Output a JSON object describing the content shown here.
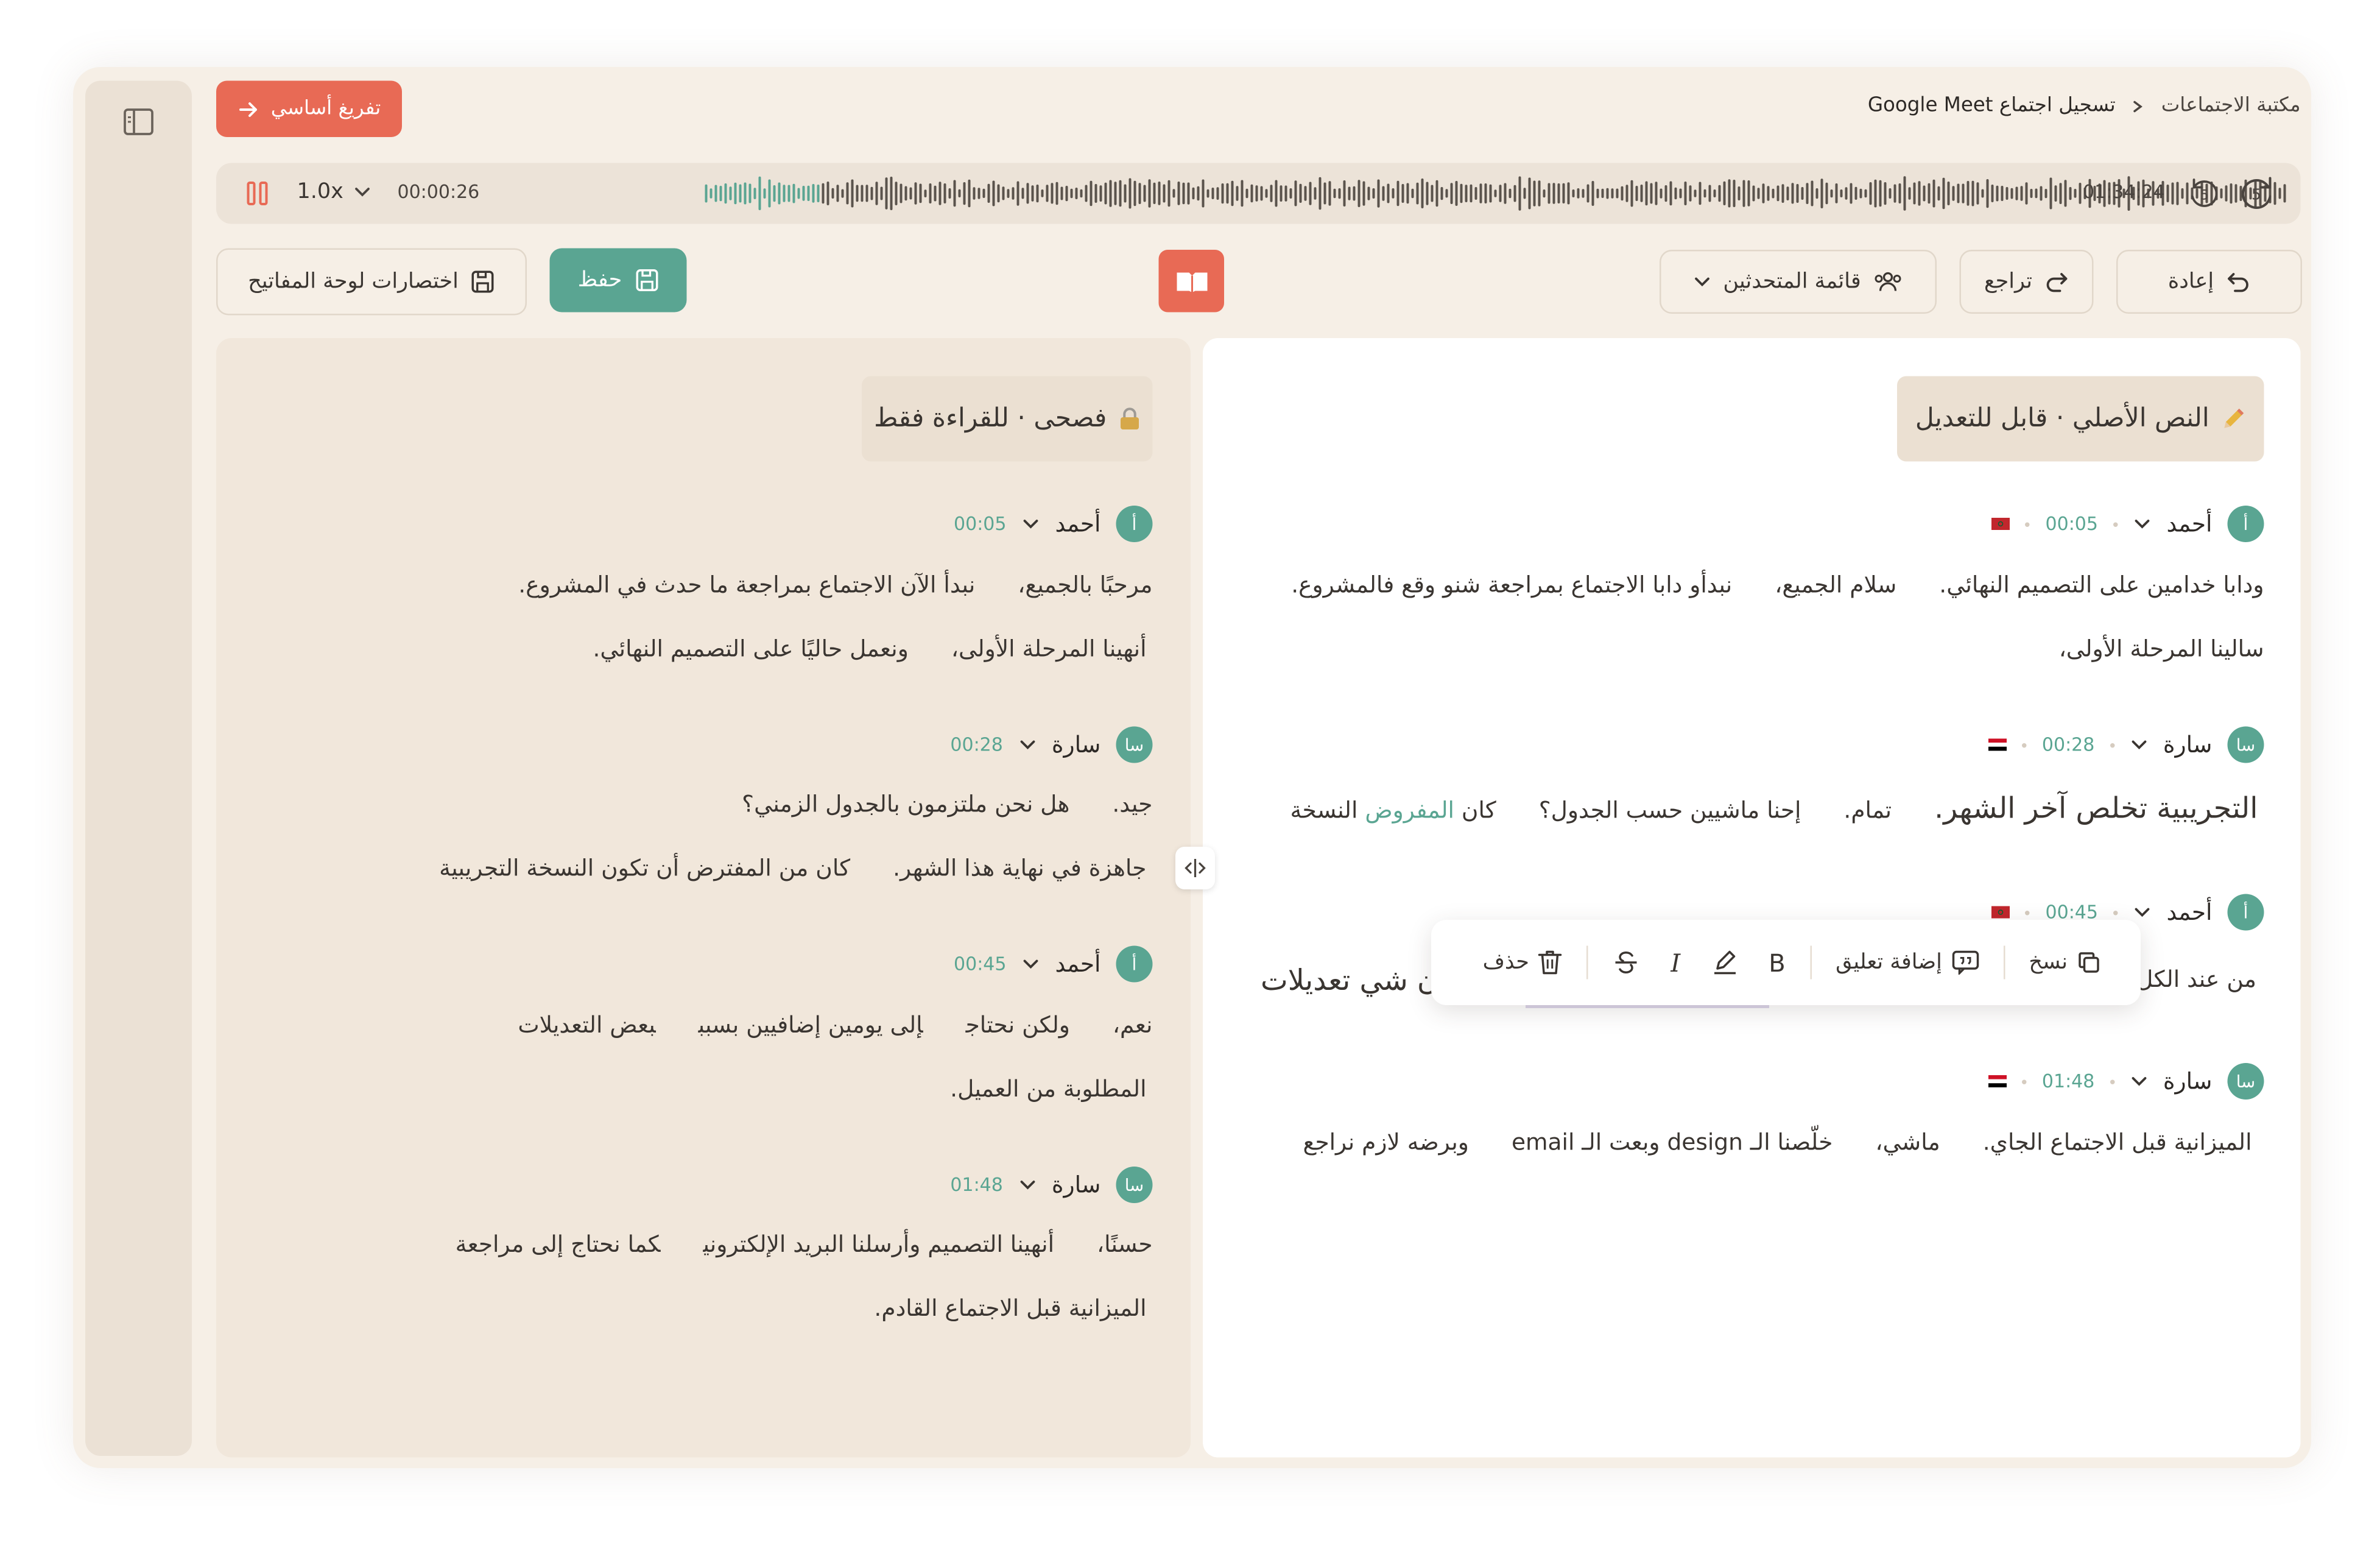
{
  "header": {
    "breadcrumb_root": "مكتبة الاجتماعات",
    "breadcrumb_current": "تسجيل اجتماع Google Meet",
    "primary_button": "تفريغ أساسي"
  },
  "player": {
    "current_time": "00:00:26",
    "total_time": "01:34:24",
    "speed": "1.0x",
    "skip_back": "5",
    "skip_forward": "5",
    "progress": 0.005
  },
  "toolbar": {
    "redo": "إعادة",
    "undo": "تراجع",
    "speakers": "قائمة المتحدثين",
    "save": "حفظ",
    "shortcuts": "اختصارات لوحة المفاتيح"
  },
  "right_panel": {
    "tag": "النص الأصلي · قابل للتعديل",
    "blocks": [
      {
        "avatar": "أ",
        "speaker": "أحمد",
        "time": "00:05",
        "flag": "morocco",
        "line1": [
          "ودابا خدامين على التصميم النهائي.",
          "سلام الجميع،",
          "نبدأو دابا الاجتماع بمراجعة شنو وقع فالمشروع."
        ],
        "line2": [
          "سالينا المرحلة الأولى،"
        ]
      },
      {
        "avatar": "سا",
        "speaker": "سارة",
        "time": "00:28",
        "flag": "egypt",
        "line1_big": "التجريبية تخلص آخر الشهر.",
        "line1": [
          "تمام.",
          "إحنا ماشيين حسب الجدول؟"
        ],
        "line1_pre": "كان",
        "line1_hl": "المفروض",
        "line1_post": "النسخة"
      },
      {
        "avatar": "أ",
        "speaker": "أحمد",
        "time": "00:45",
        "flag": "morocco",
        "line1_start": "من عند الكل",
        "line1_end": "ن شي تعديلات"
      },
      {
        "avatar": "سا",
        "speaker": "سارة",
        "time": "01:48",
        "flag": "egypt",
        "line1": [
          "الميزانية قبل الاجتماع الجاي.",
          "ماشي،",
          "خلّصنا الـ design وبعت الـ email",
          "وبرضه لازم نراجع"
        ]
      }
    ]
  },
  "left_panel": {
    "tag": "فصحى · للقراءة فقط",
    "blocks": [
      {
        "avatar": "أ",
        "speaker": "أحمد",
        "time": "00:05",
        "line1": [
          "مرحبًا بالجميع،",
          "نبدأ الآن الاجتماع بمراجعة ما حدث في المشروع."
        ],
        "line2": [
          "أنهينا المرحلة الأولى،",
          "ونعمل حاليًا على التصميم النهائي."
        ]
      },
      {
        "avatar": "سا",
        "speaker": "سارة",
        "time": "00:28",
        "line1": [
          "جيد.",
          "هل نحن ملتزمون بالجدول الزمني؟"
        ],
        "line2": [
          "جاهزة في نهاية هذا الشهر.",
          "كان من المفترض أن تكون النسخة التجريبية"
        ]
      },
      {
        "avatar": "أ",
        "speaker": "أحمد",
        "time": "00:45",
        "line1": [
          "نعم،",
          "ولكن نحتاج",
          "إلى يومين إضافيين بسبب",
          "بعض التعديلات"
        ],
        "line2": [
          "المطلوبة من العميل."
        ]
      },
      {
        "avatar": "سا",
        "speaker": "سارة",
        "time": "01:48",
        "line1": [
          "حسنًا،",
          "أنهينا التصميم وأرسلنا البريد الإلكتروني",
          "كما نحتاج إلى مراجعة"
        ],
        "line2": [
          "الميزانية قبل الاجتماع القادم."
        ]
      }
    ]
  },
  "selection_toolbar": {
    "copy": "نسخ",
    "comment": "إضافة تعليق",
    "bold": "B",
    "italic": "I",
    "delete": "حذف"
  },
  "colors": {
    "accent_red": "#e86a55",
    "accent_green": "#5aa592",
    "background": "#f6efe6"
  }
}
